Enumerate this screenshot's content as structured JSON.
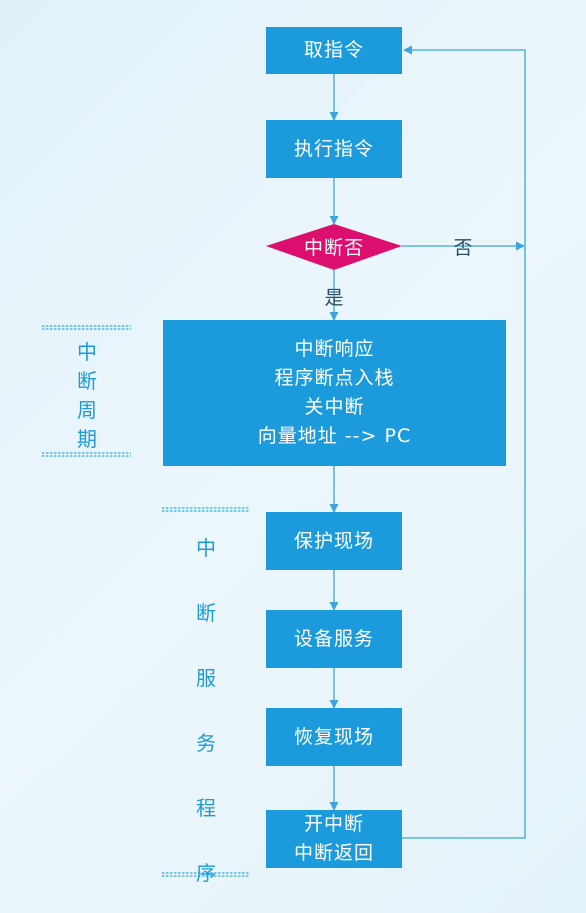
{
  "nodes": {
    "fetch": "取指令",
    "execute": "执行指令",
    "decision": "中断否",
    "cycle": [
      "中断响应",
      "程序断点入栈",
      "关中断",
      "向量地址 --> PC"
    ],
    "protect": "保护现场",
    "service": "设备服务",
    "restore": "恢复现场",
    "finish": [
      "开中断",
      "中断返回"
    ]
  },
  "edges": {
    "yes": "是",
    "no": "否"
  },
  "groups": {
    "interrupt_cycle": [
      "中",
      "断",
      "周",
      "期"
    ],
    "service_routine": [
      "中",
      "断",
      "服",
      "务",
      "程",
      "序"
    ]
  },
  "colors": {
    "box": "#1c9bdc",
    "decision": "#dc0f6e",
    "line": "#3ba6dd",
    "text_accent": "#1c9bdc"
  }
}
